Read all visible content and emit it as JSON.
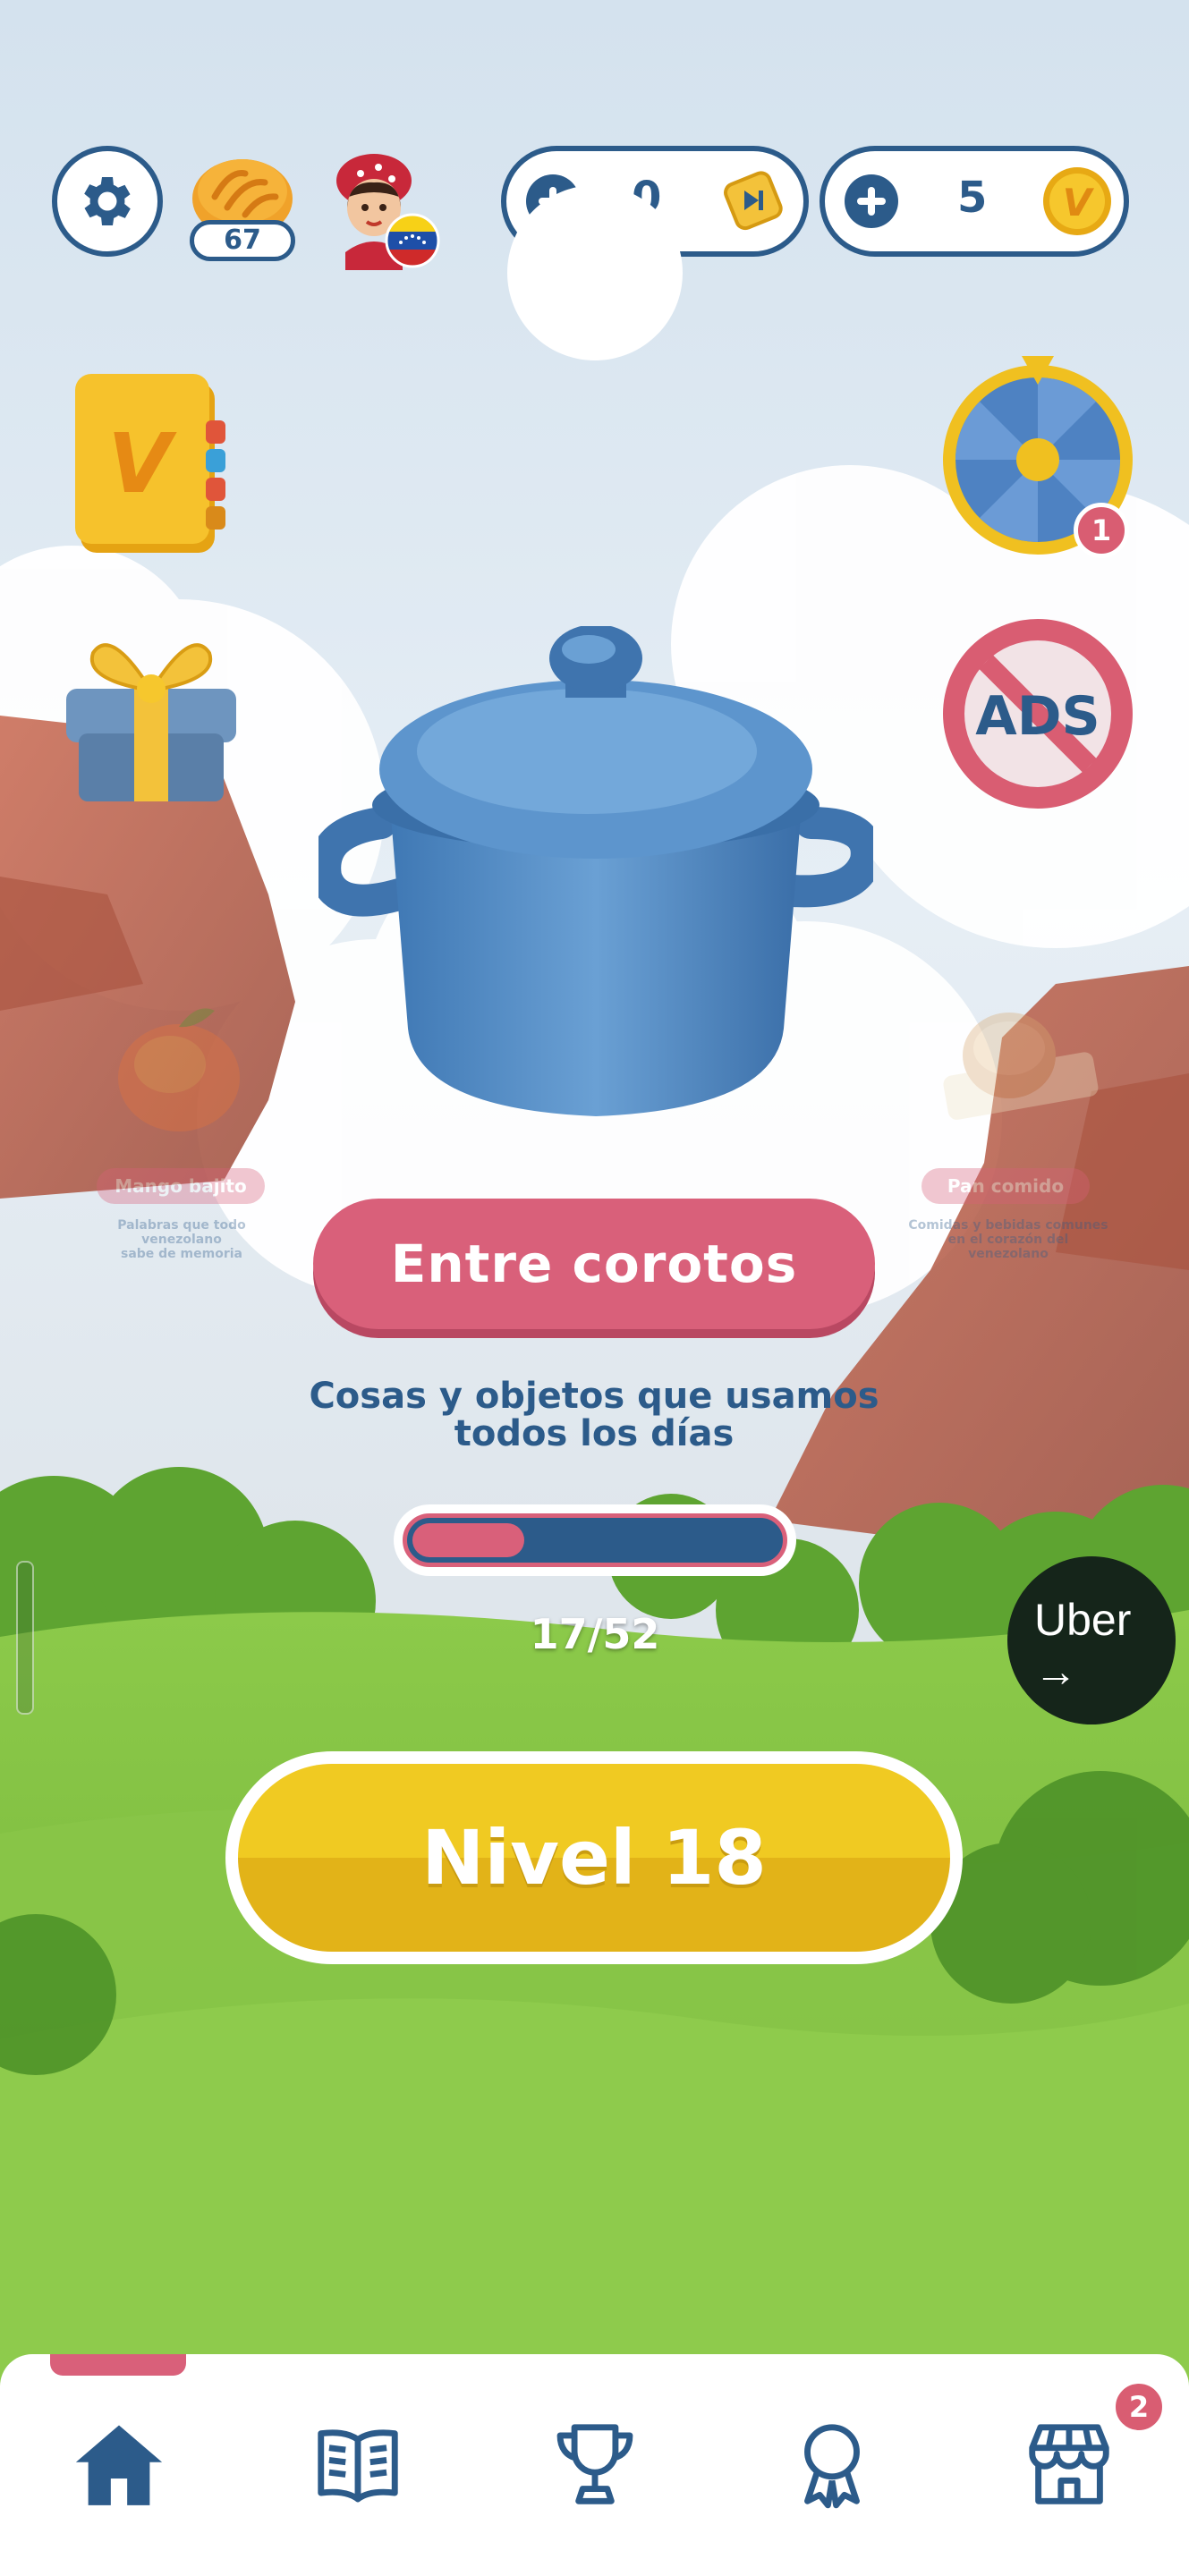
{
  "top_bar": {
    "settings_icon": "gear-icon",
    "bread_count": "67",
    "avatar_icon": "avatar-with-venezuela-flag",
    "hints_count": "0",
    "coins_count": "5"
  },
  "left_actions": [
    {
      "icon": "dictionary-book-icon"
    },
    {
      "icon": "gift-box-icon"
    }
  ],
  "right_actions": {
    "wheel_icon": "prize-wheel-icon",
    "wheel_badge": "1",
    "no_ads_label": "ADS"
  },
  "category": {
    "title": "Entre corotos",
    "description_line1": "Cosas y objetos que usamos",
    "description_line2": "todos los días",
    "progress_current": 17,
    "progress_total": 52,
    "progress_text": "17/52"
  },
  "side_categories": {
    "left": {
      "title": "Mango bajito",
      "desc_line1": "Palabras que todo venezolano",
      "desc_line2": "sabe de memoria"
    },
    "right": {
      "title": "Pan comido",
      "desc_line1": "Comidas y bebidas comunes",
      "desc_line2": "en el corazón del",
      "desc_line3": "venezolano"
    }
  },
  "play_button": {
    "label": "Nivel 18"
  },
  "ad": {
    "line1": "Uber",
    "line2": "→"
  },
  "bottom_nav": {
    "items": [
      {
        "icon": "home-icon",
        "active": true
      },
      {
        "icon": "book-icon"
      },
      {
        "icon": "trophy-icon"
      },
      {
        "icon": "award-ribbon-icon"
      },
      {
        "icon": "shop-icon",
        "badge": "2"
      }
    ]
  },
  "colors": {
    "navy": "#2c5b8a",
    "pink": "#d9607a",
    "yellow": "#f0ca22",
    "grass": "#7cc04a"
  }
}
